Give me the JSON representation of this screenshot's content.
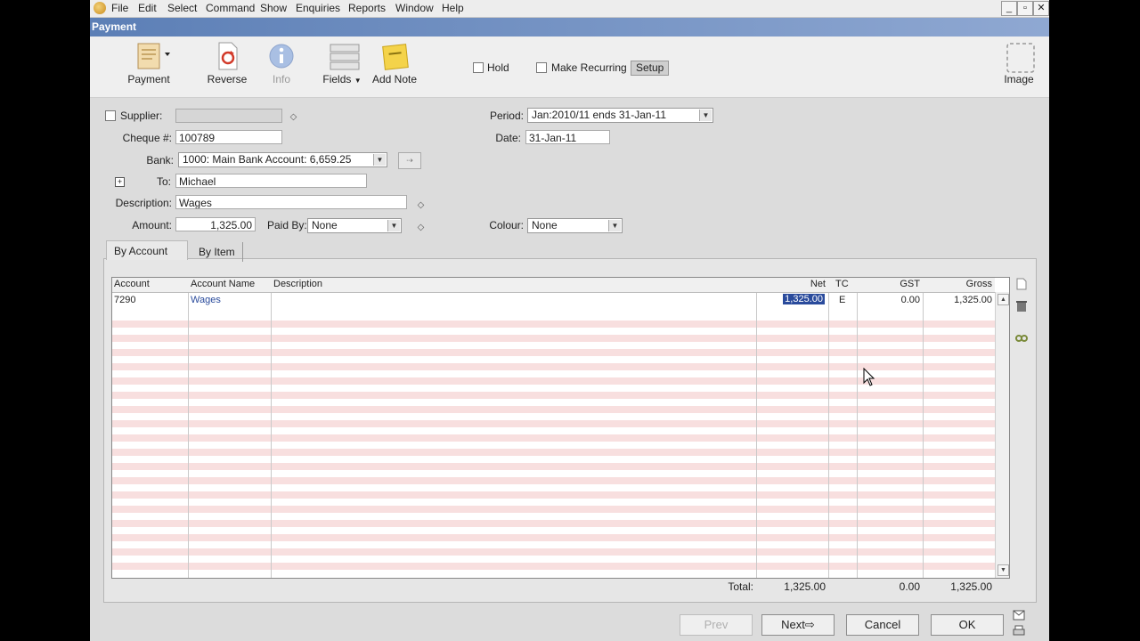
{
  "menu": [
    "File",
    "Edit",
    "Select",
    "Command",
    "Show",
    "Enquiries",
    "Reports",
    "Window",
    "Help"
  ],
  "window_controls": [
    "_",
    "▫",
    "✕"
  ],
  "window_title": "Payment",
  "toolbar": {
    "payment": "Payment",
    "reverse": "Reverse",
    "info": "Info",
    "fields": "Fields",
    "add_note": "Add Note",
    "image": "Image",
    "hold": "Hold",
    "make_recurring": "Make Recurring",
    "setup": "Setup"
  },
  "form": {
    "supplier_label": "Supplier:",
    "supplier_value": "",
    "cheque_label": "Cheque #:",
    "cheque_value": "100789",
    "bank_label": "Bank:",
    "bank_value": "1000: Main Bank Account: 6,659.25",
    "to_label": "To:",
    "to_value": "Michael",
    "description_label": "Description:",
    "description_value": "Wages",
    "amount_label": "Amount:",
    "amount_value": "1,325.00",
    "paid_by_label": "Paid By:",
    "paid_by_value": "None",
    "period_label": "Period:",
    "period_value": "Jan:2010/11 ends 31-Jan-11",
    "date_label": "Date:",
    "date_value": "31-Jan-11",
    "colour_label": "Colour:",
    "colour_value": "None"
  },
  "tabs": [
    "By Account",
    "By Item"
  ],
  "grid": {
    "headers": [
      "Account",
      "Account Name",
      "Description",
      "Net",
      "TC",
      "GST",
      "Gross"
    ],
    "rows": [
      {
        "account": "7290",
        "account_name": "Wages",
        "description": "",
        "net": "1,325.00",
        "tc": "E",
        "gst": "0.00",
        "gross": "1,325.00"
      }
    ]
  },
  "totals": {
    "label": "Total:",
    "net": "1,325.00",
    "gst": "0.00",
    "gross": "1,325.00"
  },
  "buttons": {
    "prev": "Prev",
    "next": "Next",
    "cancel": "Cancel",
    "ok": "OK"
  },
  "colors": {
    "title_bar": "#5c7fb6",
    "grid_stripe": "#f8dfdf",
    "selection": "#2a4b9c"
  }
}
